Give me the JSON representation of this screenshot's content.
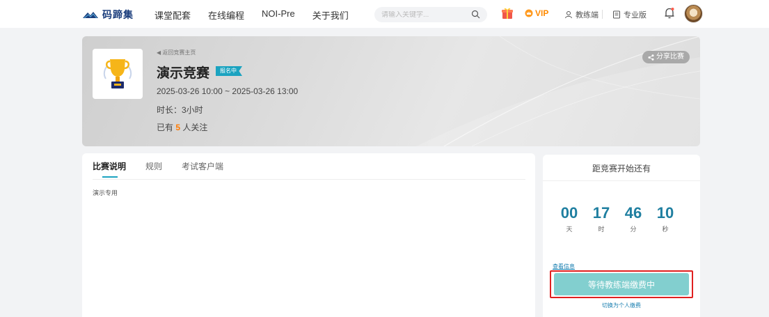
{
  "header": {
    "logo_text": "码蹄集",
    "nav": [
      "课堂配套",
      "在线编程",
      "NOI-Pre",
      "关于我们"
    ],
    "search_placeholder": "请输入关键字...",
    "vip_label": "VIP",
    "coach_label": "教练端",
    "pro_label": "专业版",
    "colors": {
      "brand": "#1a3d7c",
      "vip": "#ff8a00"
    }
  },
  "banner": {
    "back_link": "◀ 返回竞赛主页",
    "title": "演示竞赛",
    "status": "报名中",
    "time_range": "2025-03-26 10:00 ~ 2025-03-26 13:00",
    "duration": "时长：3小时",
    "followers_prefix": "已有 ",
    "followers_count": "5",
    "followers_suffix": " 人关注",
    "share_label": "分享比赛"
  },
  "main": {
    "tabs": [
      {
        "label": "比赛说明",
        "active": true
      },
      {
        "label": "规则",
        "active": false
      },
      {
        "label": "考试客户端",
        "active": false
      }
    ],
    "description": "演示专用"
  },
  "side": {
    "countdown_title": "距竞赛开始还有",
    "countdown": [
      {
        "value": "00",
        "unit": "天"
      },
      {
        "value": "17",
        "unit": "时"
      },
      {
        "value": "46",
        "unit": "分"
      },
      {
        "value": "10",
        "unit": "秒"
      }
    ],
    "info_link": "查看信息",
    "wait_button": "等待教练端缴费中",
    "switch_link": "切换为个人缴费",
    "colors": {
      "accent": "#1f7fa0",
      "button": "#82cfcf",
      "highlight": "#e02020"
    }
  }
}
